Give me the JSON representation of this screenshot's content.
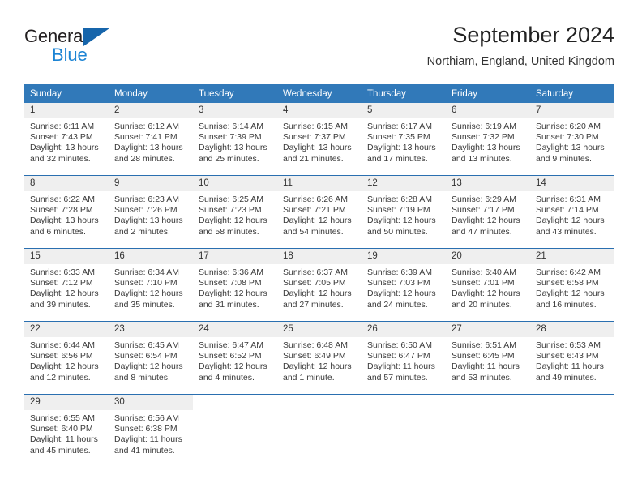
{
  "brand": {
    "name_part1": "General",
    "name_part2": "Blue",
    "logo_icon": "triangle-logo-icon",
    "accent_dark": "#1665ab",
    "accent_light": "#1c84d4"
  },
  "header": {
    "title": "September 2024",
    "location": "Northiam, England, United Kingdom"
  },
  "theme": {
    "header_row_bg": "#3179b9",
    "date_band_bg": "#efefef",
    "row_divider": "#2a6fb0"
  },
  "calendar": {
    "weekday_headers": [
      "Sunday",
      "Monday",
      "Tuesday",
      "Wednesday",
      "Thursday",
      "Friday",
      "Saturday"
    ],
    "labels": {
      "sunrise": "Sunrise:",
      "sunset": "Sunset:",
      "daylight": "Daylight:"
    },
    "weeks": [
      [
        {
          "day": "1",
          "sunrise": "Sunrise: 6:11 AM",
          "sunset": "Sunset: 7:43 PM",
          "daylight_line1": "Daylight: 13 hours",
          "daylight_line2": "and 32 minutes."
        },
        {
          "day": "2",
          "sunrise": "Sunrise: 6:12 AM",
          "sunset": "Sunset: 7:41 PM",
          "daylight_line1": "Daylight: 13 hours",
          "daylight_line2": "and 28 minutes."
        },
        {
          "day": "3",
          "sunrise": "Sunrise: 6:14 AM",
          "sunset": "Sunset: 7:39 PM",
          "daylight_line1": "Daylight: 13 hours",
          "daylight_line2": "and 25 minutes."
        },
        {
          "day": "4",
          "sunrise": "Sunrise: 6:15 AM",
          "sunset": "Sunset: 7:37 PM",
          "daylight_line1": "Daylight: 13 hours",
          "daylight_line2": "and 21 minutes."
        },
        {
          "day": "5",
          "sunrise": "Sunrise: 6:17 AM",
          "sunset": "Sunset: 7:35 PM",
          "daylight_line1": "Daylight: 13 hours",
          "daylight_line2": "and 17 minutes."
        },
        {
          "day": "6",
          "sunrise": "Sunrise: 6:19 AM",
          "sunset": "Sunset: 7:32 PM",
          "daylight_line1": "Daylight: 13 hours",
          "daylight_line2": "and 13 minutes."
        },
        {
          "day": "7",
          "sunrise": "Sunrise: 6:20 AM",
          "sunset": "Sunset: 7:30 PM",
          "daylight_line1": "Daylight: 13 hours",
          "daylight_line2": "and 9 minutes."
        }
      ],
      [
        {
          "day": "8",
          "sunrise": "Sunrise: 6:22 AM",
          "sunset": "Sunset: 7:28 PM",
          "daylight_line1": "Daylight: 13 hours",
          "daylight_line2": "and 6 minutes."
        },
        {
          "day": "9",
          "sunrise": "Sunrise: 6:23 AM",
          "sunset": "Sunset: 7:26 PM",
          "daylight_line1": "Daylight: 13 hours",
          "daylight_line2": "and 2 minutes."
        },
        {
          "day": "10",
          "sunrise": "Sunrise: 6:25 AM",
          "sunset": "Sunset: 7:23 PM",
          "daylight_line1": "Daylight: 12 hours",
          "daylight_line2": "and 58 minutes."
        },
        {
          "day": "11",
          "sunrise": "Sunrise: 6:26 AM",
          "sunset": "Sunset: 7:21 PM",
          "daylight_line1": "Daylight: 12 hours",
          "daylight_line2": "and 54 minutes."
        },
        {
          "day": "12",
          "sunrise": "Sunrise: 6:28 AM",
          "sunset": "Sunset: 7:19 PM",
          "daylight_line1": "Daylight: 12 hours",
          "daylight_line2": "and 50 minutes."
        },
        {
          "day": "13",
          "sunrise": "Sunrise: 6:29 AM",
          "sunset": "Sunset: 7:17 PM",
          "daylight_line1": "Daylight: 12 hours",
          "daylight_line2": "and 47 minutes."
        },
        {
          "day": "14",
          "sunrise": "Sunrise: 6:31 AM",
          "sunset": "Sunset: 7:14 PM",
          "daylight_line1": "Daylight: 12 hours",
          "daylight_line2": "and 43 minutes."
        }
      ],
      [
        {
          "day": "15",
          "sunrise": "Sunrise: 6:33 AM",
          "sunset": "Sunset: 7:12 PM",
          "daylight_line1": "Daylight: 12 hours",
          "daylight_line2": "and 39 minutes."
        },
        {
          "day": "16",
          "sunrise": "Sunrise: 6:34 AM",
          "sunset": "Sunset: 7:10 PM",
          "daylight_line1": "Daylight: 12 hours",
          "daylight_line2": "and 35 minutes."
        },
        {
          "day": "17",
          "sunrise": "Sunrise: 6:36 AM",
          "sunset": "Sunset: 7:08 PM",
          "daylight_line1": "Daylight: 12 hours",
          "daylight_line2": "and 31 minutes."
        },
        {
          "day": "18",
          "sunrise": "Sunrise: 6:37 AM",
          "sunset": "Sunset: 7:05 PM",
          "daylight_line1": "Daylight: 12 hours",
          "daylight_line2": "and 27 minutes."
        },
        {
          "day": "19",
          "sunrise": "Sunrise: 6:39 AM",
          "sunset": "Sunset: 7:03 PM",
          "daylight_line1": "Daylight: 12 hours",
          "daylight_line2": "and 24 minutes."
        },
        {
          "day": "20",
          "sunrise": "Sunrise: 6:40 AM",
          "sunset": "Sunset: 7:01 PM",
          "daylight_line1": "Daylight: 12 hours",
          "daylight_line2": "and 20 minutes."
        },
        {
          "day": "21",
          "sunrise": "Sunrise: 6:42 AM",
          "sunset": "Sunset: 6:58 PM",
          "daylight_line1": "Daylight: 12 hours",
          "daylight_line2": "and 16 minutes."
        }
      ],
      [
        {
          "day": "22",
          "sunrise": "Sunrise: 6:44 AM",
          "sunset": "Sunset: 6:56 PM",
          "daylight_line1": "Daylight: 12 hours",
          "daylight_line2": "and 12 minutes."
        },
        {
          "day": "23",
          "sunrise": "Sunrise: 6:45 AM",
          "sunset": "Sunset: 6:54 PM",
          "daylight_line1": "Daylight: 12 hours",
          "daylight_line2": "and 8 minutes."
        },
        {
          "day": "24",
          "sunrise": "Sunrise: 6:47 AM",
          "sunset": "Sunset: 6:52 PM",
          "daylight_line1": "Daylight: 12 hours",
          "daylight_line2": "and 4 minutes."
        },
        {
          "day": "25",
          "sunrise": "Sunrise: 6:48 AM",
          "sunset": "Sunset: 6:49 PM",
          "daylight_line1": "Daylight: 12 hours",
          "daylight_line2": "and 1 minute."
        },
        {
          "day": "26",
          "sunrise": "Sunrise: 6:50 AM",
          "sunset": "Sunset: 6:47 PM",
          "daylight_line1": "Daylight: 11 hours",
          "daylight_line2": "and 57 minutes."
        },
        {
          "day": "27",
          "sunrise": "Sunrise: 6:51 AM",
          "sunset": "Sunset: 6:45 PM",
          "daylight_line1": "Daylight: 11 hours",
          "daylight_line2": "and 53 minutes."
        },
        {
          "day": "28",
          "sunrise": "Sunrise: 6:53 AM",
          "sunset": "Sunset: 6:43 PM",
          "daylight_line1": "Daylight: 11 hours",
          "daylight_line2": "and 49 minutes."
        }
      ],
      [
        {
          "day": "29",
          "sunrise": "Sunrise: 6:55 AM",
          "sunset": "Sunset: 6:40 PM",
          "daylight_line1": "Daylight: 11 hours",
          "daylight_line2": "and 45 minutes."
        },
        {
          "day": "30",
          "sunrise": "Sunrise: 6:56 AM",
          "sunset": "Sunset: 6:38 PM",
          "daylight_line1": "Daylight: 11 hours",
          "daylight_line2": "and 41 minutes."
        },
        {
          "day": "",
          "sunrise": "",
          "sunset": "",
          "daylight_line1": "",
          "daylight_line2": ""
        },
        {
          "day": "",
          "sunrise": "",
          "sunset": "",
          "daylight_line1": "",
          "daylight_line2": ""
        },
        {
          "day": "",
          "sunrise": "",
          "sunset": "",
          "daylight_line1": "",
          "daylight_line2": ""
        },
        {
          "day": "",
          "sunrise": "",
          "sunset": "",
          "daylight_line1": "",
          "daylight_line2": ""
        },
        {
          "day": "",
          "sunrise": "",
          "sunset": "",
          "daylight_line1": "",
          "daylight_line2": ""
        }
      ]
    ]
  }
}
